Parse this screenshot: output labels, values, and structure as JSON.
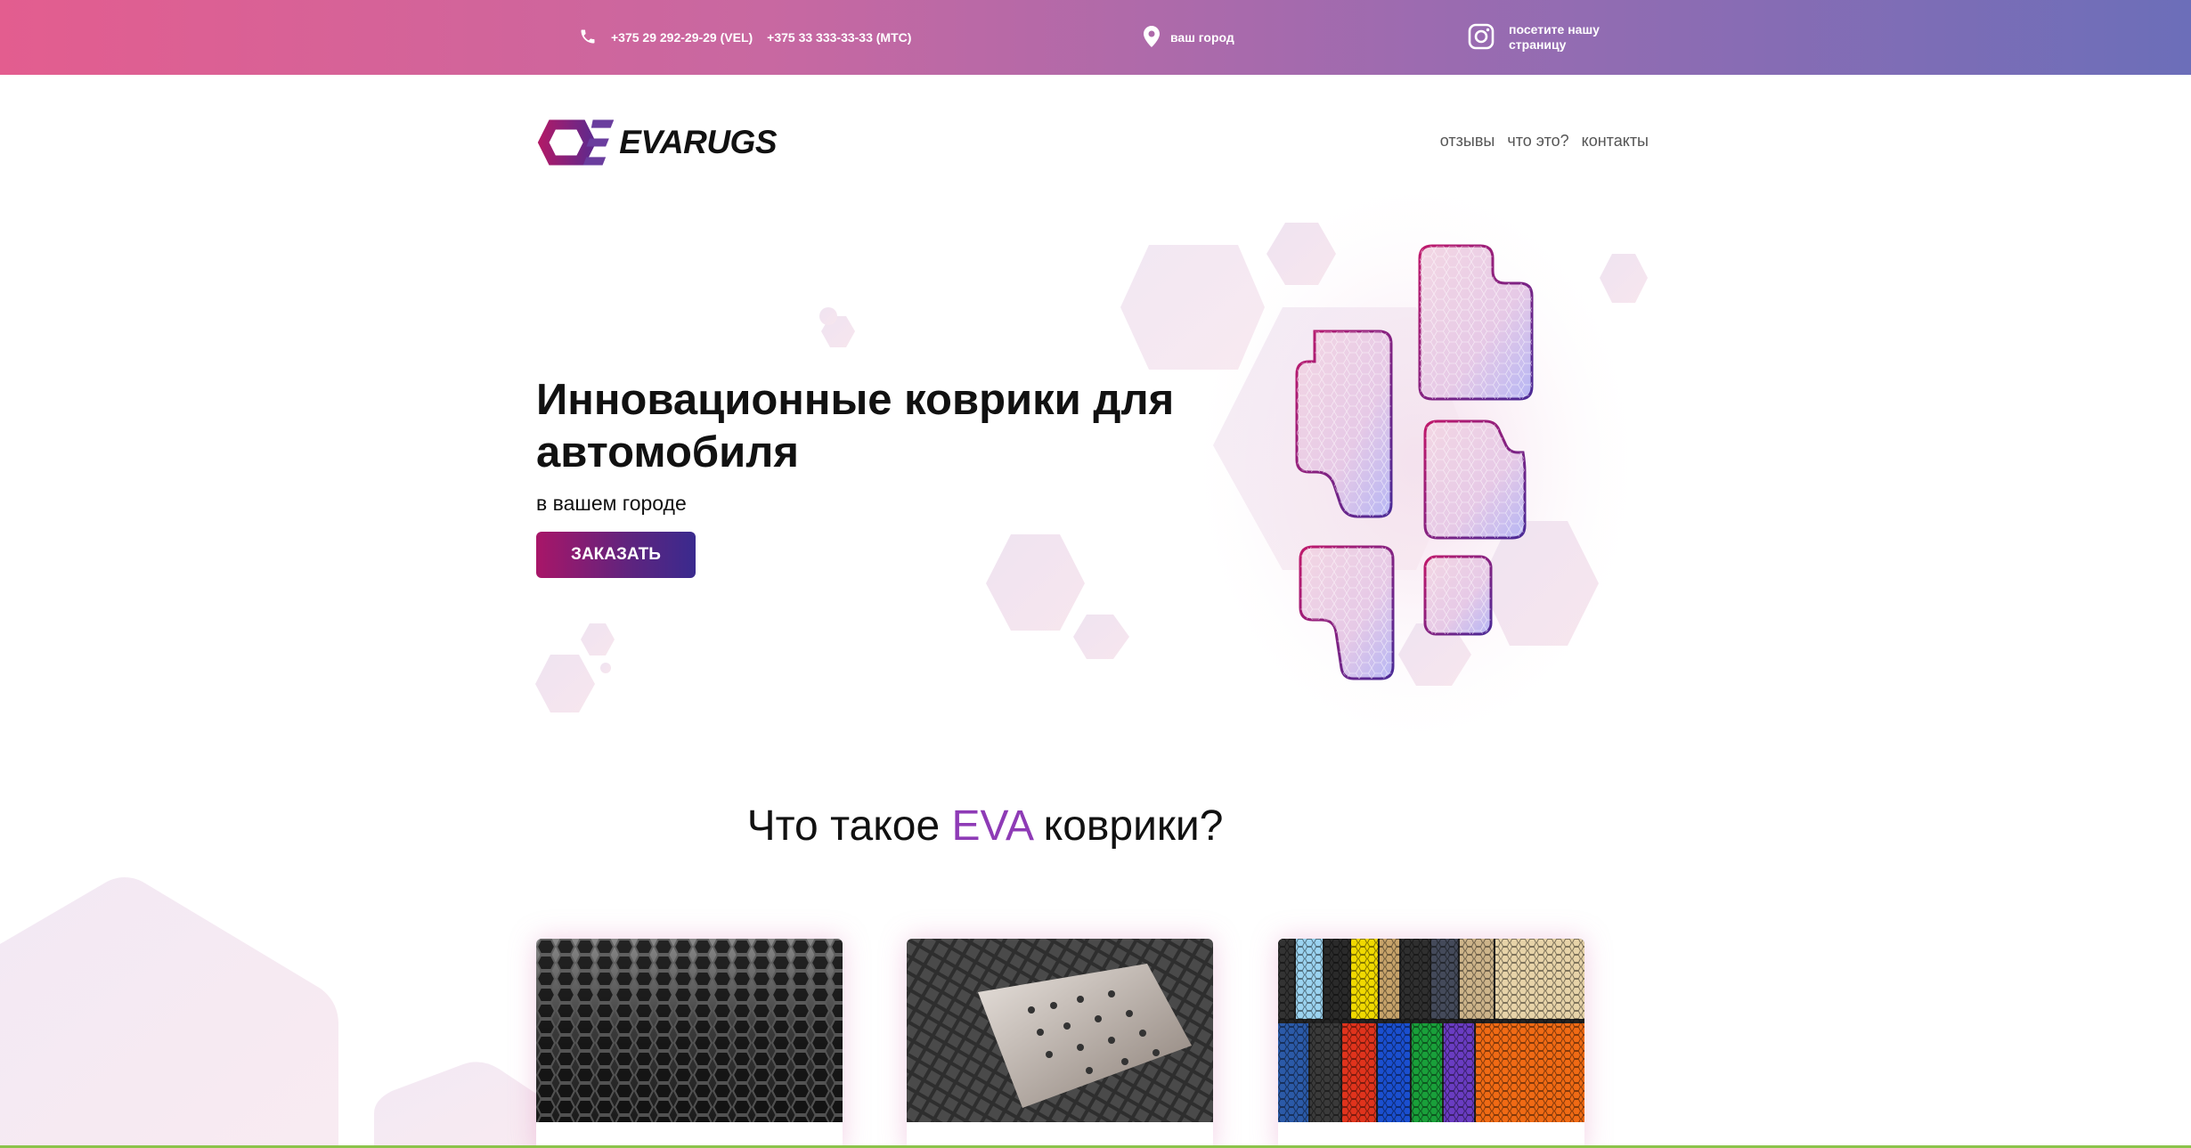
{
  "topbar": {
    "phone1": "+375 29 292-29-29 (VEL)",
    "phone2": "+375 33 333-33-33 (МТС)",
    "city": "ваш город",
    "instagram": "посетите нашу страницу",
    "icons": [
      "phone-icon",
      "location-pin-icon",
      "instagram-icon"
    ]
  },
  "header": {
    "logo": "EVARUGS",
    "nav": [
      "отзывы",
      "что это?",
      "контакты"
    ]
  },
  "hero": {
    "title": "Инновационные коврики для автомобиля",
    "subtitle": "в вашем городе",
    "button": "ЗАКАЗАТЬ"
  },
  "section": {
    "title_before": "Что такое ",
    "title_accent": "EVA",
    "title_after": " коврики?"
  },
  "colors": {
    "gradient_start": "#e35d8f",
    "gradient_end": "#6c6eb9",
    "accent": "#8e3bb6",
    "button_start": "#a81668",
    "button_end": "#3a2a8e"
  }
}
